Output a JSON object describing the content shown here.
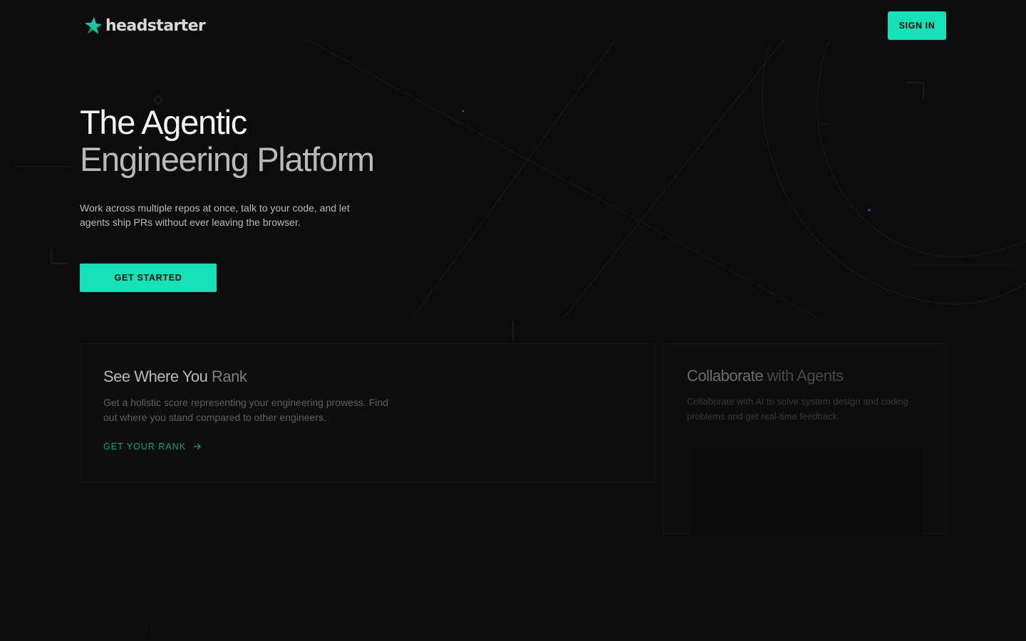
{
  "header": {
    "brand": "headstarter",
    "sign_in_label": "SIGN IN"
  },
  "hero": {
    "title_line1": "The Agentic",
    "title_line2": "Engineering Platform",
    "subtitle": "Work across multiple repos at once, talk to your code, and let agents ship PRs without ever leaving the browser.",
    "cta_label": "GET STARTED"
  },
  "cards": {
    "rank": {
      "title_strong": "See Where You",
      "title_dim": "Rank",
      "description": "Get a holistic score representing your engineering prowess. Find out where you stand compared to other engineers.",
      "link_label": "GET YOUR RANK"
    },
    "collab": {
      "title_strong": "Collaborate",
      "title_dim": "with Agents",
      "description": "Collaborate with AI to solve system design and coding problems and get real-time feedback."
    }
  },
  "colors": {
    "accent": "#16e0b8",
    "link": "#139c82",
    "background": "#0c0c0d"
  },
  "icons": {
    "logo": "star-rocket-icon",
    "link_arrow": "arrow-right-icon"
  }
}
